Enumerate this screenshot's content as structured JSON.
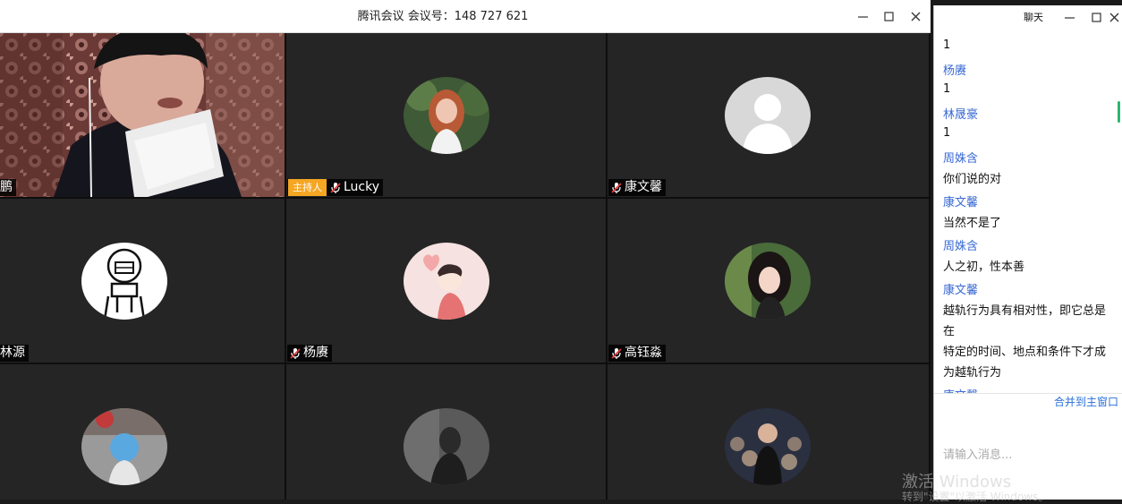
{
  "meeting": {
    "title": "腾讯会议 会议号：148 727 621"
  },
  "participants": [
    {
      "name": "鹏",
      "host": false,
      "video": true
    },
    {
      "name": "Lucky",
      "host": true,
      "host_label": "主持人"
    },
    {
      "name": "康文馨",
      "host": false
    },
    {
      "name": "林源",
      "host": false
    },
    {
      "name": "杨赓",
      "host": false
    },
    {
      "name": "高钰淼",
      "host": false
    },
    {
      "name": "",
      "host": false
    },
    {
      "name": "",
      "host": false
    },
    {
      "name": "",
      "host": false
    }
  ],
  "chat": {
    "title": "聊天",
    "messages": [
      {
        "sender": "",
        "text": "1"
      },
      {
        "sender": "杨赓",
        "text": "1"
      },
      {
        "sender": "林晟豪",
        "text": "1"
      },
      {
        "sender": "周姝含",
        "text": "你们说的对"
      },
      {
        "sender": "康文馨",
        "text": "当然不是了"
      },
      {
        "sender": "周姝含",
        "text": "人之初，性本善"
      },
      {
        "sender": "康文馨",
        "text_lines": [
          "越轨行为具有相对性，即它总是",
          "在",
          "特定的时间、地点和条件下才成",
          "为越轨行为"
        ]
      }
    ],
    "merge_label": "合并到主窗口",
    "input_placeholder": "请输入消息..."
  },
  "watermark": {
    "line1": "激活 Windows",
    "line2": "转到\"设置\"以激活 Windows。"
  },
  "colors": {
    "host_badge": "#f5a623",
    "sender_name": "#3a6ad4",
    "merge_link": "#2a6fdb"
  }
}
